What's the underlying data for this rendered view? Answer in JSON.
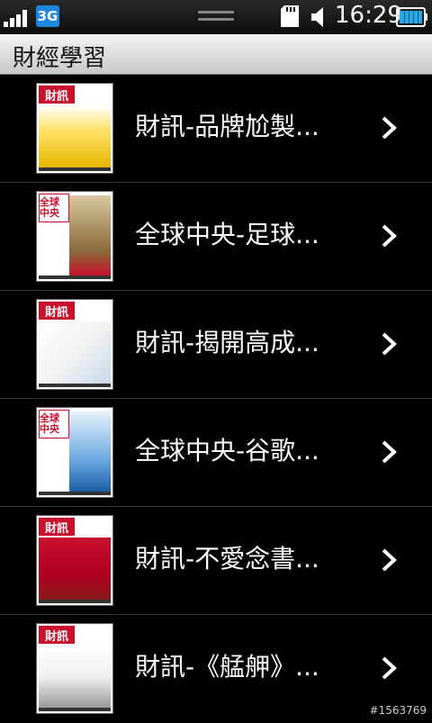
{
  "status_bar": {
    "network_badge": "3G",
    "time": "16:29",
    "icons": [
      "signal-icon",
      "network-3g-icon",
      "drag-handle-icon",
      "sd-card-icon",
      "volume-icon",
      "battery-icon"
    ]
  },
  "title_bar": {
    "title": "財經學習"
  },
  "list": {
    "items": [
      {
        "label": "財訊-品牌尬製...",
        "cover_title": "財訊",
        "cover_color": "#c8102e"
      },
      {
        "label": "全球中央-足球...",
        "cover_title": "全球中央",
        "cover_color": "#7a5a2a"
      },
      {
        "label": "財訊-揭開高成...",
        "cover_title": "財訊",
        "cover_color": "#c8102e"
      },
      {
        "label": "全球中央-谷歌...",
        "cover_title": "全球中央",
        "cover_color": "#1c5fa8"
      },
      {
        "label": "財訊-不愛念書...",
        "cover_title": "財訊",
        "cover_color": "#c8102e"
      },
      {
        "label": "財訊-《艋舺》...",
        "cover_title": "財訊",
        "cover_color": "#c8102e"
      }
    ]
  },
  "watermark": "#1563769",
  "colors": {
    "background": "#000000",
    "title_bar": "#e0e0e0",
    "text": "#ffffff",
    "badge_blue": "#1f86e0",
    "battery_blue": "#27a9e6"
  }
}
